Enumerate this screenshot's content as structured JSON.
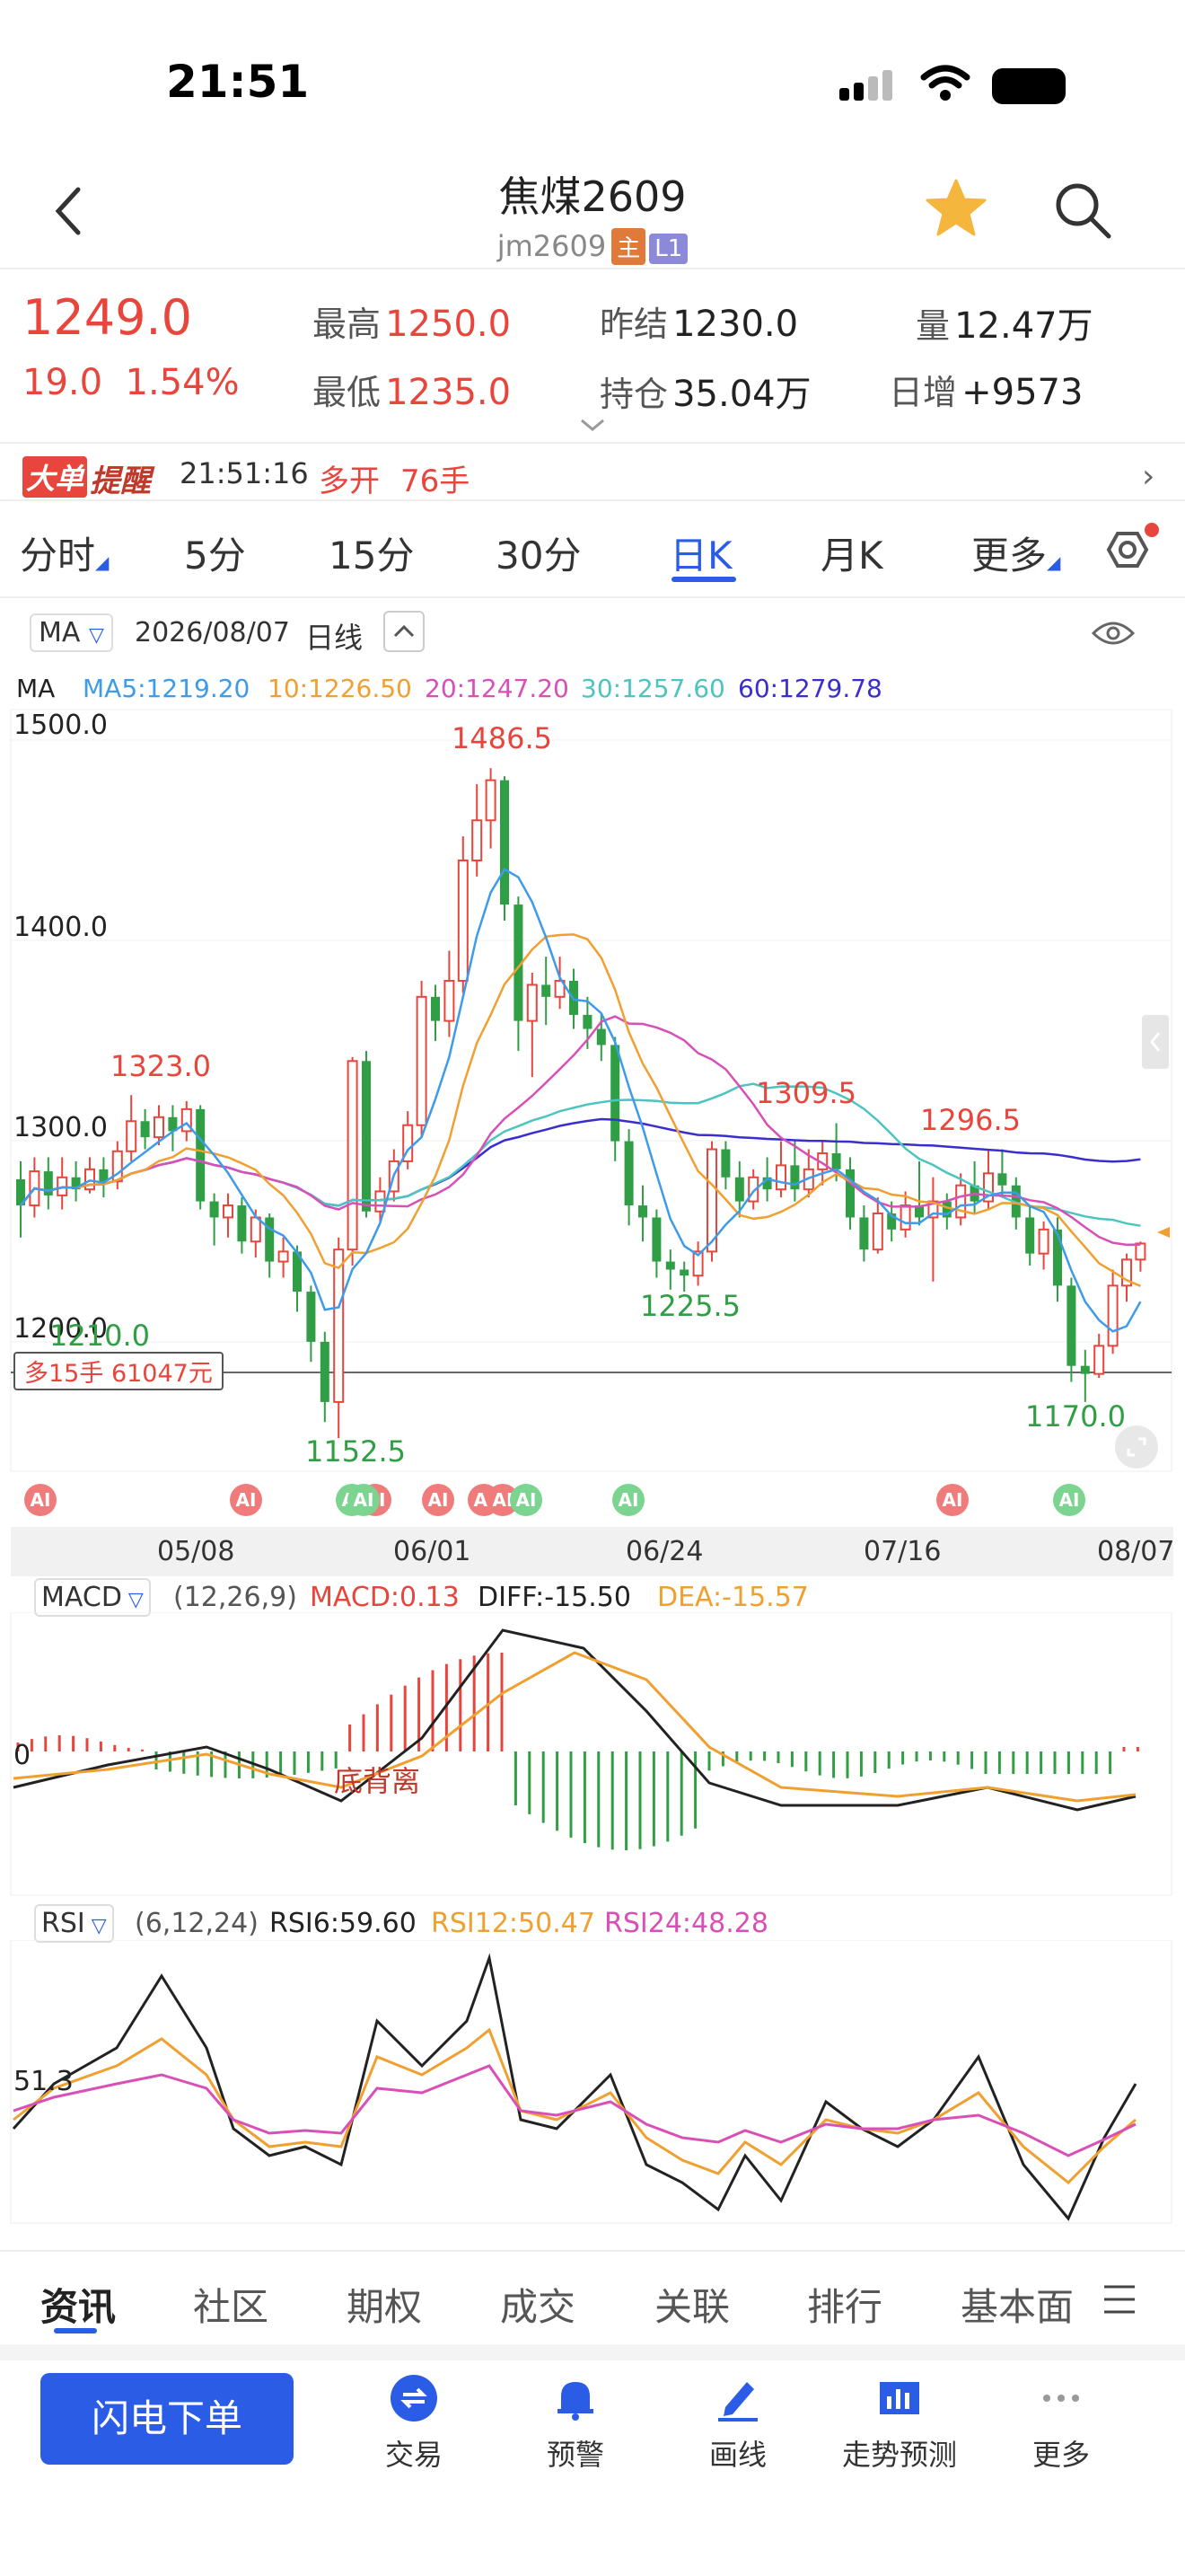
{
  "status_bar": {
    "time": "21:51"
  },
  "header": {
    "title": "焦煤2609",
    "code": "jm2609",
    "badge_main": "主",
    "badge_level": "L1"
  },
  "quote": {
    "price": "1249.0",
    "change": "19.0",
    "change_pct": "1.54%",
    "high_label": "最高",
    "high": "1250.0",
    "low_label": "最低",
    "low": "1235.0",
    "prev_settle_label": "昨结",
    "prev_settle": "1230.0",
    "open_interest_label": "持仓",
    "open_interest": "35.04万",
    "volume_label": "量",
    "volume": "12.47万",
    "daily_increase_label": "日增",
    "daily_increase": "+9573"
  },
  "alert": {
    "tag": "大单",
    "text": "提醒",
    "time": "21:51:16",
    "action": "多开",
    "lots": "76手"
  },
  "period_tabs": [
    {
      "label": "分时"
    },
    {
      "label": "5分"
    },
    {
      "label": "15分"
    },
    {
      "label": "30分"
    },
    {
      "label": "日K",
      "active": true
    },
    {
      "label": "月K"
    },
    {
      "label": "更多"
    }
  ],
  "kline_toolbar": {
    "indicator": "MA",
    "date": "2026/08/07",
    "period": "日线"
  },
  "ma_legend": {
    "label": "MA",
    "ma5": "MA5:1219.20",
    "ma10": "10:1226.50",
    "ma20": "20:1247.20",
    "ma30": "30:1257.60",
    "ma60": "60:1279.78",
    "colors": {
      "ma5": "#3d9be9",
      "ma10": "#f0a030",
      "ma20": "#d94fb8",
      "ma30": "#4cc4c0",
      "ma60": "#3a2ed0"
    }
  },
  "kline_axis": {
    "y_labels": [
      "1500.0",
      "1400.0",
      "1300.0",
      "1200.0"
    ],
    "annotations": [
      "1486.5",
      "1323.0",
      "1309.5",
      "1296.5",
      "1225.5",
      "1152.5",
      "1170.0",
      "1210.0"
    ],
    "position_label": "多15手 61047元"
  },
  "date_axis": [
    "05/08",
    "06/01",
    "06/24",
    "07/16",
    "08/07"
  ],
  "ai_marker": "AI",
  "macd": {
    "indicator": "MACD",
    "params": "(12,26,9)",
    "macd": "MACD:0.13",
    "diff": "DIFF:-15.50",
    "dea": "DEA:-15.57",
    "zero_label": "0",
    "annotation": "底背离"
  },
  "rsi": {
    "indicator": "RSI",
    "params": "(6,12,24)",
    "rsi6": "RSI6:59.60",
    "rsi12": "RSI12:50.47",
    "rsi24": "RSI24:48.28",
    "level_label": "51.3"
  },
  "bottom_tabs": [
    "资讯",
    "社区",
    "期权",
    "成交",
    "关联",
    "排行",
    "基本面"
  ],
  "bottom_nav": {
    "flash_order": "闪电下单",
    "items": [
      "交易",
      "预警",
      "画线",
      "走势预测",
      "更多"
    ]
  },
  "colors": {
    "up": "#e8453c",
    "down": "#2f9e44",
    "accent": "#2b5ce6"
  }
}
